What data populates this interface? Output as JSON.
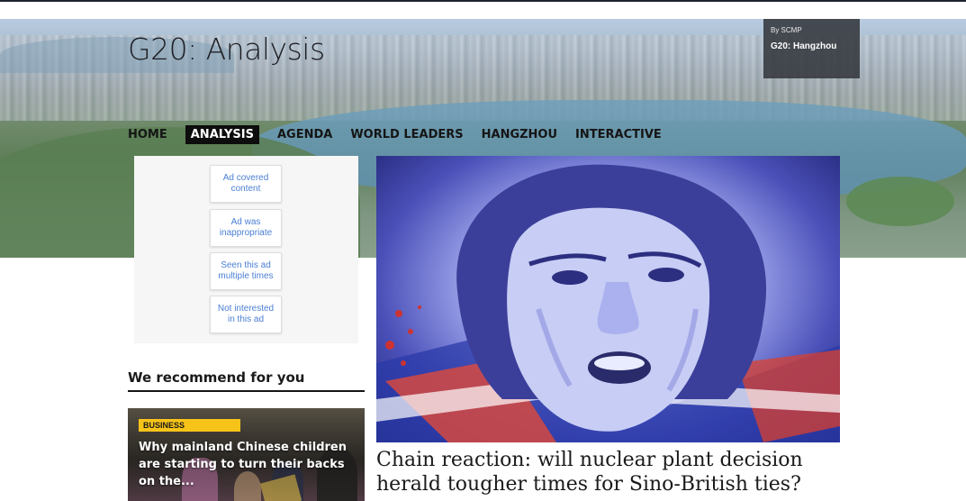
{
  "header": {
    "site_title": "G20: Analysis",
    "badge_by": "By SCMP",
    "badge_name": "G20: Hangzhou"
  },
  "nav": {
    "items": [
      {
        "label": "HOME",
        "active": false
      },
      {
        "label": "ANALYSIS",
        "active": true
      },
      {
        "label": "AGENDA",
        "active": false
      },
      {
        "label": "WORLD LEADERS",
        "active": false
      },
      {
        "label": "HANGZHOU",
        "active": false
      },
      {
        "label": "INTERACTIVE",
        "active": false
      }
    ]
  },
  "ad_feedback": {
    "options": [
      "Ad covered content",
      "Ad was inappropriate",
      "Seen this ad multiple times",
      "Not interested in this ad"
    ]
  },
  "feature": {
    "title": "Chain reaction: will nuclear plant decision herald tougher times for Sino-British ties?"
  },
  "recommend": {
    "heading": "We recommend for you",
    "card": {
      "category": "BUSINESS",
      "title": "Why mainland Chinese children are starting to turn their backs on the..."
    }
  },
  "colors": {
    "accent_badge": "#f6c319",
    "nav_active_bg": "#0d0d0d",
    "ad_link": "#4a7fd4"
  }
}
